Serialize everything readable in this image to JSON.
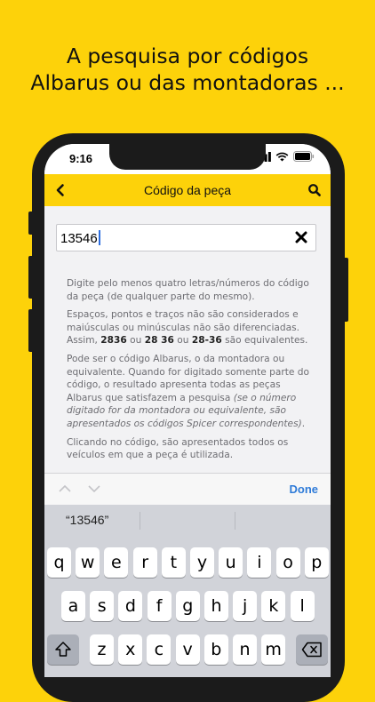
{
  "headline": {
    "line1": "A pesquisa por códigos",
    "line2": "Albarus ou das montadoras ..."
  },
  "status_bar": {
    "time": "9:16"
  },
  "navbar": {
    "title": "Código da peça"
  },
  "search": {
    "value": "13546"
  },
  "help": {
    "p1": "Digite pelo menos quatro letras/números do código da peça (de qualquer parte do mesmo).",
    "p2_a": "Espaços, pontos e traços não são considerados e maiúsculas ou minúsculas não são diferenciadas. Assim, ",
    "p2_b1": "2836",
    "p2_ou1": " ou ",
    "p2_b2": "28 36",
    "p2_ou2": " ou ",
    "p2_b3": "28-36",
    "p2_c": " são equivalentes.",
    "p3_a": "Pode ser o código Albarus, o da montadora ou equivalente. Quando for digitado somente parte do código, o resultado apresenta todas as peças Albarus que satisfazem a pesquisa ",
    "p3_i": "(se o número digitado for da montadora ou equivalente, são apresentados os códigos Spicer correspondentes)",
    "p3_c": ".",
    "p4": "Clicando no código, são apresentados todos os veículos em que a peça é utilizada."
  },
  "accessory": {
    "done": "Done"
  },
  "keyboard": {
    "suggestion": "“13546”",
    "row1": [
      "q",
      "w",
      "e",
      "r",
      "t",
      "y",
      "u",
      "i",
      "o",
      "p"
    ],
    "row2": [
      "a",
      "s",
      "d",
      "f",
      "g",
      "h",
      "j",
      "k",
      "l"
    ],
    "row3": [
      "z",
      "x",
      "c",
      "v",
      "b",
      "n",
      "m"
    ]
  },
  "colors": {
    "brand": "#FDD20A",
    "link": "#2f7bd8"
  }
}
